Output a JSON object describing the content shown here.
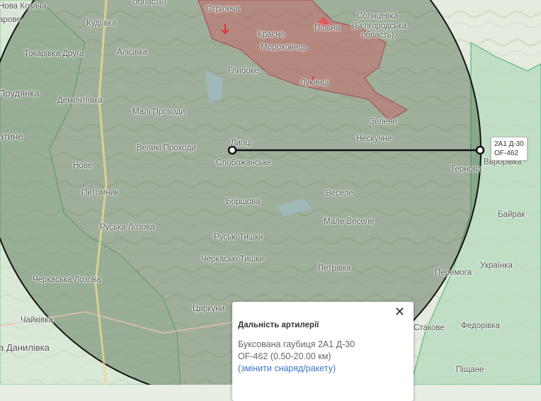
{
  "places": [
    {
      "id": "nova-kozacha",
      "text": "Нова Козача"
    },
    {
      "id": "oblast1",
      "text": "область)"
    },
    {
      "id": "strilecha",
      "text": "Стрілеча"
    },
    {
      "id": "solntsevka",
      "text": "Солнцевка"
    },
    {
      "id": "belgorodska",
      "text": "(Бєлгородська"
    },
    {
      "id": "oblast2",
      "text": "область)"
    },
    {
      "id": "pylna",
      "text": "Пільна"
    },
    {
      "id": "aroove",
      "text": "арове"
    },
    {
      "id": "kudiivka",
      "text": "Кудіївка"
    },
    {
      "id": "krasne",
      "text": "Красне"
    },
    {
      "id": "morokhovets",
      "text": "Мороховець"
    },
    {
      "id": "tokarivka",
      "text": "Токарівка Друга"
    },
    {
      "id": "alisivka",
      "text": "Алісівка"
    },
    {
      "id": "hlyboke",
      "text": "Глибоке"
    },
    {
      "id": "luptsi",
      "text": "Лукянці"
    },
    {
      "id": "prudianka",
      "text": "Прудянка"
    },
    {
      "id": "dementiivka",
      "text": "Дементіївка"
    },
    {
      "id": "mali-prokhody",
      "text": "Малі Проходи"
    },
    {
      "id": "zelene",
      "text": "Зелене"
    },
    {
      "id": "atyne",
      "text": "атине"
    },
    {
      "id": "neskuchne",
      "text": "Нескучне"
    },
    {
      "id": "velyki-prokhody",
      "text": "Великі Проходи"
    },
    {
      "id": "lyptsi",
      "text": "Липці"
    },
    {
      "id": "nove",
      "text": "Нове"
    },
    {
      "id": "slobozhanske",
      "text": "Слобожанське"
    },
    {
      "id": "ternova",
      "text": "Тернова"
    },
    {
      "id": "vovchansk",
      "text": "Вврорівка"
    },
    {
      "id": "pytomnyk",
      "text": "Питомник"
    },
    {
      "id": "vesele",
      "text": "Веселе"
    },
    {
      "id": "borshchova",
      "text": "Борщова"
    },
    {
      "id": "baiarak",
      "text": "Байрак"
    },
    {
      "id": "ruska-lozova",
      "text": "Руська Лозова"
    },
    {
      "id": "male-vesele",
      "text": "Мале Веселе"
    },
    {
      "id": "ruski-tyshky",
      "text": "Руські Тишки"
    },
    {
      "id": "cherkaski-tyshky",
      "text": "Черкаські Тишки"
    },
    {
      "id": "ukrainka",
      "text": "Українка"
    },
    {
      "id": "petrivka",
      "text": "Петрівка"
    },
    {
      "id": "peremoha",
      "text": "Перемога"
    },
    {
      "id": "cherkaska-lozova",
      "text": "Черкаська Лозова"
    },
    {
      "id": "tsyrkuny",
      "text": "Циркуни"
    },
    {
      "id": "chaikivka",
      "text": "Чайківка"
    },
    {
      "id": "fedorivka",
      "text": "Федорівка"
    },
    {
      "id": "danylivka",
      "text": "а Данилівка"
    },
    {
      "id": "stakove",
      "text": "Стакове"
    },
    {
      "id": "pishchane",
      "text": "Піщане"
    }
  ],
  "weapon_label": {
    "line1": "2А1 Д-30",
    "line2": "OF-462"
  },
  "popup": {
    "title": "Дальність артилерії",
    "close": "✕",
    "weapon": "Буксована гаубиця 2А1 Д-30",
    "range": "OF-462 (0.50-20.00 км)",
    "change_link": "(змінити снаряд/ракету)"
  },
  "colors": {
    "range_fill": "#3f5e3c",
    "occupied": "#c46a6a",
    "liberated": "#6cc28a",
    "line": "#111111"
  }
}
